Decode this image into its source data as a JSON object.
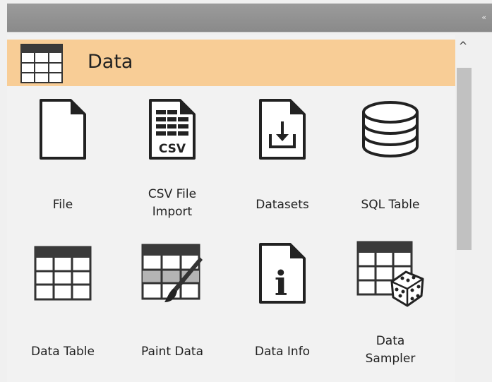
{
  "panel": {
    "collapse_glyph": "«",
    "category": {
      "title": "Data",
      "icon": "table-icon",
      "background": "#f8cd96"
    },
    "scroll_up_glyph": "^"
  },
  "widgets": [
    {
      "label": "File",
      "icon": "file-icon"
    },
    {
      "label_line1": "CSV File",
      "label_line2": "Import",
      "icon": "csv-file-icon",
      "icon_text": "CSV"
    },
    {
      "label": "Datasets",
      "icon": "datasets-download-icon"
    },
    {
      "label": "SQL Table",
      "icon": "database-icon"
    },
    {
      "label": "Data Table",
      "icon": "data-table-icon"
    },
    {
      "label": "Paint Data",
      "icon": "paint-data-icon"
    },
    {
      "label": "Data Info",
      "icon": "data-info-icon",
      "icon_text": "i"
    },
    {
      "label_line1": "Data",
      "label_line2": "Sampler",
      "icon": "data-sampler-icon"
    }
  ]
}
